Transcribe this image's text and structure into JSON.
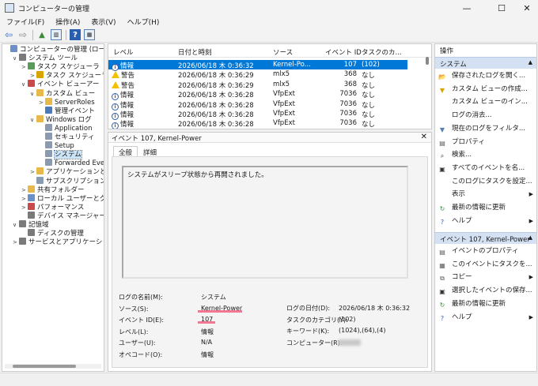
{
  "window": {
    "title": "コンピューターの管理",
    "minimize": "—",
    "maximize": "☐",
    "close": "✕"
  },
  "menu": [
    "ファイル(F)",
    "操作(A)",
    "表示(V)",
    "ヘルプ(H)"
  ],
  "toolbar_icons": [
    "back-arrow-icon",
    "forward-arrow-icon",
    "folder-up-icon",
    "console-tree-icon",
    "help-icon",
    "properties-icon"
  ],
  "tree": [
    {
      "label": "コンピューターの管理 (ローカル",
      "indent": 0,
      "exp": "",
      "icon": "#6b8fc7"
    },
    {
      "label": "システム ツール",
      "indent": 1,
      "exp": "∨",
      "icon": "#7a7a7a"
    },
    {
      "label": "タスク スケジューラ",
      "indent": 2,
      "exp": ">",
      "icon": "#5a9a5a"
    },
    {
      "label": "タスク スケジューラ",
      "indent": 3,
      "exp": ">",
      "icon": "#d7a400"
    },
    {
      "label": "イベント ビューアー",
      "indent": 2,
      "exp": "∨",
      "icon": "#c84a4a"
    },
    {
      "label": "カスタム ビュー",
      "indent": 3,
      "exp": "∨",
      "icon": "#e8b84a"
    },
    {
      "label": "ServerRoles",
      "indent": 4,
      "exp": ">",
      "icon": "#e8b84a"
    },
    {
      "label": "管理イベント",
      "indent": 4,
      "exp": "",
      "icon": "#4a7ab8"
    },
    {
      "label": "Windows ログ",
      "indent": 3,
      "exp": "∨",
      "icon": "#e8b84a"
    },
    {
      "label": "Application",
      "indent": 4,
      "exp": "",
      "icon": "#8a9ab0"
    },
    {
      "label": "セキュリティ",
      "indent": 4,
      "exp": "",
      "icon": "#8a9ab0"
    },
    {
      "label": "Setup",
      "indent": 4,
      "exp": "",
      "icon": "#8a9ab0"
    },
    {
      "label": "システム",
      "indent": 4,
      "exp": "",
      "icon": "#8a9ab0",
      "selected": true
    },
    {
      "label": "Forwarded Eve",
      "indent": 4,
      "exp": "",
      "icon": "#8a9ab0"
    },
    {
      "label": "アプリケーションとサ",
      "indent": 3,
      "exp": ">",
      "icon": "#e8b84a"
    },
    {
      "label": "サブスクリプション",
      "indent": 3,
      "exp": "",
      "icon": "#8a9ab0"
    },
    {
      "label": "共有フォルダー",
      "indent": 2,
      "exp": ">",
      "icon": "#e8b84a"
    },
    {
      "label": "ローカル ユーザーとグル",
      "indent": 2,
      "exp": ">",
      "icon": "#6b8fc7"
    },
    {
      "label": "パフォーマンス",
      "indent": 2,
      "exp": ">",
      "icon": "#c84a4a"
    },
    {
      "label": "デバイス マネージャー",
      "indent": 2,
      "exp": "",
      "icon": "#7a7a7a"
    },
    {
      "label": "記憶域",
      "indent": 1,
      "exp": "∨",
      "icon": "#7a7a7a"
    },
    {
      "label": "ディスクの管理",
      "indent": 2,
      "exp": "",
      "icon": "#7a7a7a"
    },
    {
      "label": "サービスとアプリケーション",
      "indent": 1,
      "exp": ">",
      "icon": "#7a7a7a"
    }
  ],
  "events": {
    "headers": [
      "レベル",
      "日付と時刻",
      "ソース",
      "イベント ID",
      "タスクのカ..."
    ],
    "rows": [
      {
        "level": "情報",
        "type": "info",
        "datetime": "2026/06/18 木 0:36:32",
        "source": "Kernel-Po...",
        "id": "107",
        "task": "(102)",
        "selected": true
      },
      {
        "level": "警告",
        "type": "warn",
        "datetime": "2026/06/18 木 0:36:29",
        "source": "mlx5",
        "id": "368",
        "task": "なし"
      },
      {
        "level": "警告",
        "type": "warn",
        "datetime": "2026/06/18 木 0:36:29",
        "source": "mlx5",
        "id": "368",
        "task": "なし"
      },
      {
        "level": "情報",
        "type": "info",
        "datetime": "2026/06/18 木 0:36:28",
        "source": "VfpExt",
        "id": "7036",
        "task": "なし"
      },
      {
        "level": "情報",
        "type": "info",
        "datetime": "2026/06/18 木 0:36:28",
        "source": "VfpExt",
        "id": "7036",
        "task": "なし"
      },
      {
        "level": "情報",
        "type": "info",
        "datetime": "2026/06/18 木 0:36:28",
        "source": "VfpExt",
        "id": "7036",
        "task": "なし"
      },
      {
        "level": "情報",
        "type": "info",
        "datetime": "2026/06/18 木 0:36:28",
        "source": "VfpExt",
        "id": "7036",
        "task": "なし"
      }
    ]
  },
  "detail": {
    "title": "イベント 107, Kernel-Power",
    "close": "✕",
    "tabs": [
      "全般",
      "詳細"
    ],
    "message": "システムがスリープ状態から再開されました。",
    "props_left": [
      {
        "label": "ログの名前(M):",
        "value": "システム"
      },
      {
        "label": "ソース(S):",
        "value": "Kernel-Power"
      },
      {
        "label": "イベント ID(E):",
        "value": "107"
      },
      {
        "label": "レベル(L):",
        "value": "情報"
      },
      {
        "label": "ユーザー(U):",
        "value": "N/A"
      },
      {
        "label": "オペコード(O):",
        "value": "情報"
      }
    ],
    "props_right": [
      {
        "label": "ログの日付(D):",
        "value": "2026/06/18 木 0:36:32"
      },
      {
        "label": "タスクのカテゴリ(Y):",
        "value": "(102)"
      },
      {
        "label": "キーワード(K):",
        "value": "(1024),(64),(4)"
      },
      {
        "label": "コンピューター(R):",
        "value": ""
      }
    ]
  },
  "actions": {
    "header": "操作",
    "section1": {
      "title": "システム",
      "items": [
        {
          "label": "保存されたログを開く...",
          "icon": "open-log-icon",
          "glyph": "📂",
          "color": "#d7a400",
          "arrow": false
        },
        {
          "label": "カスタム ビューの作成...",
          "icon": "filter-icon",
          "glyph": "▼",
          "color": "#d7a400",
          "arrow": false
        },
        {
          "label": "カスタム ビューのイン...",
          "icon": "import-icon",
          "glyph": "",
          "color": "#fff",
          "arrow": false
        },
        {
          "label": "ログの消去...",
          "icon": "clear-icon",
          "glyph": "",
          "color": "#fff",
          "arrow": false
        },
        {
          "label": "現在のログをフィルタ...",
          "icon": "filter-icon",
          "glyph": "▼",
          "color": "#5580b0",
          "arrow": false
        },
        {
          "label": "プロパティ",
          "icon": "properties-icon",
          "glyph": "▤",
          "color": "#5a5a5a",
          "arrow": false
        },
        {
          "label": "検索...",
          "icon": "find-icon",
          "glyph": "⌕",
          "color": "#333",
          "arrow": false
        },
        {
          "label": "すべてのイベントを名...",
          "icon": "save-icon",
          "glyph": "▣",
          "color": "#333",
          "arrow": false
        },
        {
          "label": "このログにタスクを設定...",
          "icon": "task-icon",
          "glyph": "",
          "color": "#fff",
          "arrow": false
        },
        {
          "label": "表示",
          "icon": "view-icon",
          "glyph": "",
          "color": "#fff",
          "arrow": true
        },
        {
          "label": "最新の情報に更新",
          "icon": "refresh-icon",
          "glyph": "↻",
          "color": "#3a8a3a",
          "arrow": false
        },
        {
          "label": "ヘルプ",
          "icon": "help-icon",
          "glyph": "?",
          "color": "#2a5fb0",
          "arrow": true
        }
      ]
    },
    "section2": {
      "title": "イベント 107, Kernel-Power",
      "items": [
        {
          "label": "イベントのプロパティ",
          "icon": "event-properties-icon",
          "glyph": "▤",
          "color": "#5a5a5a",
          "arrow": false
        },
        {
          "label": "このイベントにタスクを...",
          "icon": "attach-task-icon",
          "glyph": "▦",
          "color": "#5a5a5a",
          "arrow": false
        },
        {
          "label": "コピー",
          "icon": "copy-icon",
          "glyph": "⧉",
          "color": "#5a5a5a",
          "arrow": true
        },
        {
          "label": "選択したイベントの保存...",
          "icon": "save-icon",
          "glyph": "▣",
          "color": "#333",
          "arrow": false
        },
        {
          "label": "最新の情報に更新",
          "icon": "refresh-icon",
          "glyph": "↻",
          "color": "#3a8a3a",
          "arrow": false
        },
        {
          "label": "ヘルプ",
          "icon": "help-icon",
          "glyph": "?",
          "color": "#2a5fb0",
          "arrow": true
        }
      ]
    }
  }
}
